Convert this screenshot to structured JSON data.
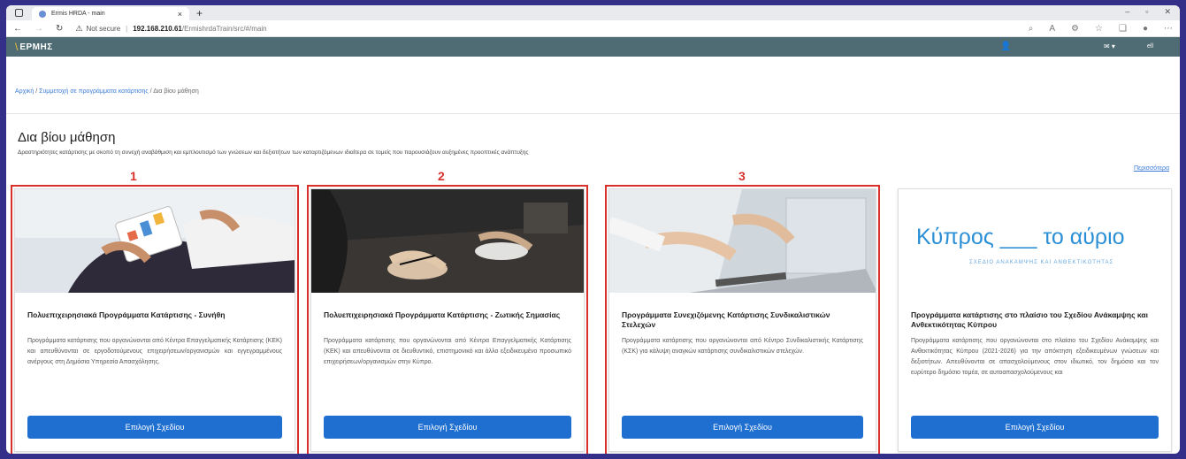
{
  "browser": {
    "tab_title": "Ermis HRDA - main",
    "not_secure": "Not secure",
    "url_host": "192.168.210.61",
    "url_path": "/ErmishrdaTrain/src/#/main"
  },
  "app": {
    "logo_text": "ΕΡΜΗΣ",
    "lang": "ell"
  },
  "breadcrumb": {
    "home": "Αρχική",
    "participation": "Συμμετοχή σε προγράμματα κατάρτισης",
    "current": "Δια βίου μάθηση"
  },
  "page": {
    "title": "Δια βίου μάθηση",
    "subtitle": "Δραστηριότητες κατάρτισης με σκοπό τη συνεχή αναβάθμιση και εμπλουτισμό των γνώσεων και δεξιοτήτων των καταρτιζόμενων ιδιαίτερα σε τομείς που παρουσιάζουν αυξημένες προοπτικές ανάπτυξης",
    "more_link": "Περισσότερα"
  },
  "annotations": [
    "1",
    "2",
    "3"
  ],
  "cards": [
    {
      "title": "Πολυεπιχειρησιακά Προγράμματα Κατάρτισης - Συνήθη",
      "body": "Προγράμματα κατάρτισης που οργανώνονται από Κέντρα Επαγγελματικής Κατάρτισης (ΚΕΚ) και απευθύνονται σε εργοδοτούμενους επιχειρήσεων/οργανισμών και εγγεγραμμένους ανέργους στη Δημόσια Υπηρεσία Απασχόλησης.",
      "button": "Επιλογή Σχεδίου"
    },
    {
      "title": "Πολυεπιχειρησιακά Προγράμματα Κατάρτισης - Ζωτικής Σημασίας",
      "body": "Προγράμματα κατάρτισης που οργανώνονται από Κέντρα Επαγγελματικής Κατάρτισης (ΚΕΚ) και απευθύνονται σε διευθυντικό, επιστημονικό και άλλο εξειδικευμένο προσωπικό επιχειρήσεων/οργανισμών στην Κύπρο.",
      "button": "Επιλογή Σχεδίου"
    },
    {
      "title": "Προγράμματα Συνεχιζόμενης Κατάρτισης Συνδικαλιστικών Στελεχών",
      "body": "Προγράμματα κατάρτισης που οργανώνονται από Κέντρο Συνδικαλιστικής Κατάρτισης (ΚΣΚ) για κάλυψη αναγκών κατάρτισης συνδικαλιστικών στελεχών.",
      "button": "Επιλογή Σχεδίου"
    },
    {
      "title": "Προγράμματα κατάρτισης στο πλαίσιο του Σχεδίου Ανάκαμψης και Ανθεκτικότητας Κύπρου",
      "body": "Προγράμματα κατάρτισης που οργανώνονται στο πλαίσιο του Σχεδίου Ανάκαμψης και Ανθεκτικότητας Κύπρου (2021-2026) για την απόκτηση εξειδικευμένων γνώσεων και δεξιοτήτων. Απευθύνονται σε απασχολούμενους στον ιδιωτικό, τον δημόσιο και τον ευρύτερο δημόσιο τομέα, σε αυτοαπασχολούμενους και",
      "button": "Επιλογή Σχεδίου",
      "logo_title": "Κύπρος ___ το αύριο",
      "logo_sub": "ΣΧΕΔΙΟ ΑΝΑΚΑΜΨΗΣ ΚΑΙ ΑΝΘΕΚΤΙΚΟΤΗΤΑΣ"
    }
  ]
}
